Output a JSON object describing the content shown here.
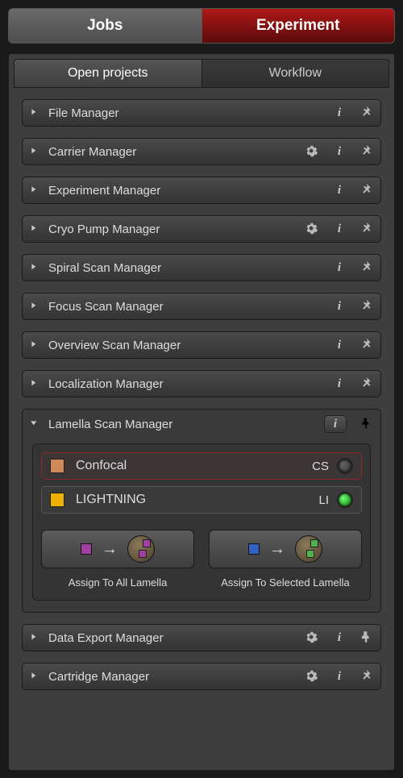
{
  "topTabs": {
    "jobs": "Jobs",
    "experiment": "Experiment",
    "active": "experiment"
  },
  "subTabs": {
    "openProjects": "Open projects",
    "workflow": "Workflow",
    "active": "openProjects"
  },
  "panels": [
    {
      "id": "file",
      "title": "File Manager",
      "gear": false,
      "pin": "normal"
    },
    {
      "id": "carrier",
      "title": "Carrier Manager",
      "gear": true,
      "pin": "normal"
    },
    {
      "id": "experiment",
      "title": "Experiment Manager",
      "gear": false,
      "pin": "normal"
    },
    {
      "id": "cryopump",
      "title": "Cryo Pump Manager",
      "gear": true,
      "pin": "normal"
    },
    {
      "id": "spiral",
      "title": "Spiral Scan Manager",
      "gear": false,
      "pin": "normal"
    },
    {
      "id": "focus",
      "title": "Focus Scan Manager",
      "gear": false,
      "pin": "normal"
    },
    {
      "id": "overview",
      "title": "Overview Scan Manager",
      "gear": false,
      "pin": "normal"
    },
    {
      "id": "localization",
      "title": "Localization Manager",
      "gear": false,
      "pin": "normal"
    }
  ],
  "expanded": {
    "title": "Lamella Scan Manager",
    "modes": [
      {
        "name": "Confocal",
        "abbr": "CS",
        "swatch": "#d08a5a",
        "on": false,
        "selected": true
      },
      {
        "name": "LIGHTNING",
        "abbr": "LI",
        "swatch": "#f0b000",
        "on": true,
        "selected": false
      }
    ],
    "assign": {
      "all": {
        "label": "Assign To All Lamella",
        "sq": "#a040a0",
        "tiles": "#a040a0"
      },
      "selected": {
        "label": "Assign To Selected Lamella",
        "sq": "#3060c0",
        "tiles": "#50b050"
      }
    }
  },
  "panelsAfter": [
    {
      "id": "dataexport",
      "title": "Data Export Manager",
      "gear": true,
      "pin": "pinned"
    },
    {
      "id": "cartridge",
      "title": "Cartridge Manager",
      "gear": true,
      "pin": "normal"
    }
  ]
}
